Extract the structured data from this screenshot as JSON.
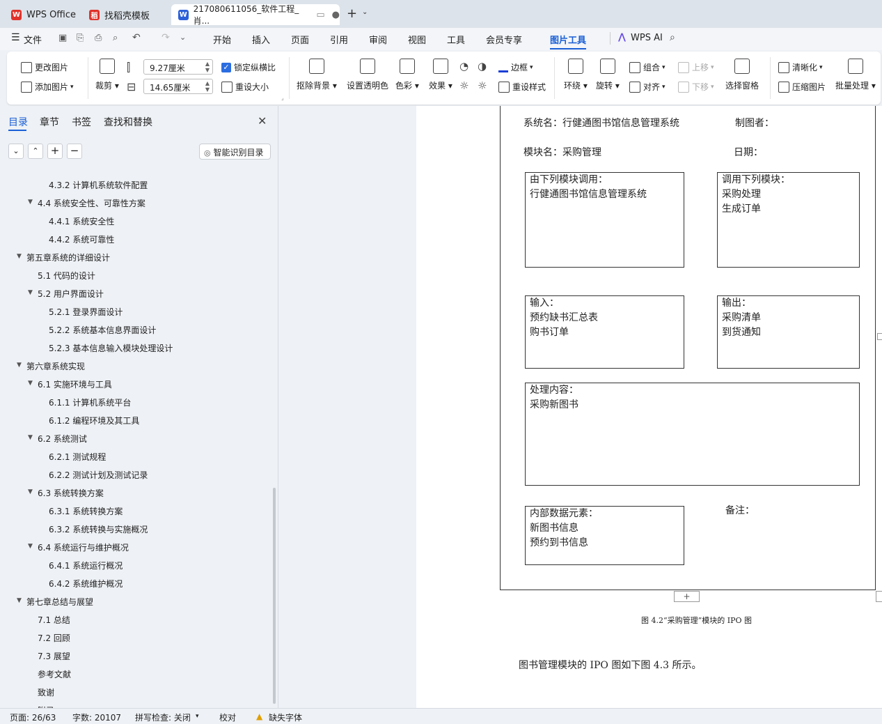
{
  "tabs": [
    {
      "label": "WPS Office"
    },
    {
      "label": "找稻壳模板"
    },
    {
      "label": "217080611056_软件工程_肖..."
    }
  ],
  "menu": {
    "file": "文件",
    "items": [
      "开始",
      "插入",
      "页面",
      "引用",
      "审阅",
      "视图",
      "工具",
      "会员专享",
      "图片工具"
    ],
    "active": "图片工具",
    "ai": "WPS AI"
  },
  "ribbon": {
    "change_pic": "更改图片",
    "add_pic": "添加图片",
    "crop": "裁剪",
    "width": "9.27厘米",
    "height": "14.65厘米",
    "lock_ratio": "锁定纵横比",
    "reset_size": "重设大小",
    "remove_bg": "抠除背景",
    "set_transparent": "设置透明色",
    "color": "色彩",
    "effect": "效果",
    "border": "边框",
    "reset_style": "重设样式",
    "wrap": "环绕",
    "rotate": "旋转",
    "group": "组合",
    "align": "对齐",
    "move_up": "上移",
    "move_down": "下移",
    "select_pane": "选择窗格",
    "sharpen": "清晰化",
    "compress": "压缩图片",
    "batch": "批量处理"
  },
  "sidebar": {
    "tabs": [
      "目录",
      "章节",
      "书签",
      "查找和替换"
    ],
    "smart_toc": "智能识别目录",
    "toc": [
      {
        "label": "4.3.2 计算机系统软件配置",
        "level": 3
      },
      {
        "label": "4.4 系统安全性、可靠性方案",
        "level": 2,
        "expanded": true
      },
      {
        "label": "4.4.1 系统安全性",
        "level": 3
      },
      {
        "label": "4.4.2 系统可靠性",
        "level": 3
      },
      {
        "label": "第五章系统的详细设计",
        "level": 1,
        "expanded": true
      },
      {
        "label": "5.1 代码的设计",
        "level": 2
      },
      {
        "label": "5.2 用户界面设计",
        "level": 2,
        "expanded": true
      },
      {
        "label": "5.2.1 登录界面设计",
        "level": 3
      },
      {
        "label": "5.2.2 系统基本信息界面设计",
        "level": 3
      },
      {
        "label": "5.2.3 基本信息输入模块处理设计",
        "level": 3
      },
      {
        "label": "第六章系统实现",
        "level": 1,
        "expanded": true
      },
      {
        "label": "6.1 实施环境与工具",
        "level": 2,
        "expanded": true
      },
      {
        "label": "6.1.1 计算机系统平台",
        "level": 3
      },
      {
        "label": "6.1.2 编程环境及其工具",
        "level": 3
      },
      {
        "label": "6.2 系统测试",
        "level": 2,
        "expanded": true
      },
      {
        "label": "6.2.1 测试规程",
        "level": 3
      },
      {
        "label": "6.2.2  测试计划及测试记录",
        "level": 3
      },
      {
        "label": "6.3 系统转换方案",
        "level": 2,
        "expanded": true
      },
      {
        "label": "6.3.1 系统转换方案",
        "level": 3
      },
      {
        "label": "6.3.2 系统转换与实施概况",
        "level": 3
      },
      {
        "label": "6.4 系统运行与维护概况",
        "level": 2,
        "expanded": true
      },
      {
        "label": "6.4.1 系统运行概况",
        "level": 3
      },
      {
        "label": "6.4.2 系统维护概况",
        "level": 3
      },
      {
        "label": "第七章总结与展望",
        "level": 1,
        "expanded": true
      },
      {
        "label": "7.1 总结",
        "level": 2
      },
      {
        "label": "7.2 回顾",
        "level": 2
      },
      {
        "label": "7.3 展望",
        "level": 2
      },
      {
        "label": "参考文献",
        "level": 2
      },
      {
        "label": "致谢",
        "level": 2
      },
      {
        "label": "附录",
        "level": 2
      }
    ]
  },
  "document": {
    "system_name": "系统名：行健通图书馆信息管理系统",
    "drawer": "制图者：",
    "module_name": "模块名：采购管理",
    "date": "日期：",
    "called_by": [
      "由下列模块调用：",
      "行健通图书馆信息管理系统"
    ],
    "calls": [
      "调用下列模块：",
      "采购处理",
      "生成订单"
    ],
    "input": [
      "输入：",
      "预约缺书汇总表",
      "购书订单"
    ],
    "output": [
      "输出：",
      "采购清单",
      "到货通知"
    ],
    "process": [
      "处理内容：",
      "采购新图书"
    ],
    "internal": [
      "内部数据元素：",
      "新图书信息",
      "预约到书信息"
    ],
    "remark": "备注：",
    "caption": "图 4.2“采购管理”模块的 IPO 图",
    "paragraph": "图书管理模块的 IPO 图如下图 4.3 所示。"
  },
  "status": {
    "page": "页面: 26/63",
    "words": "字数: 20107",
    "spell": "拼写检查: 关闭",
    "proof": "校对",
    "missing_font": "缺失字体"
  }
}
